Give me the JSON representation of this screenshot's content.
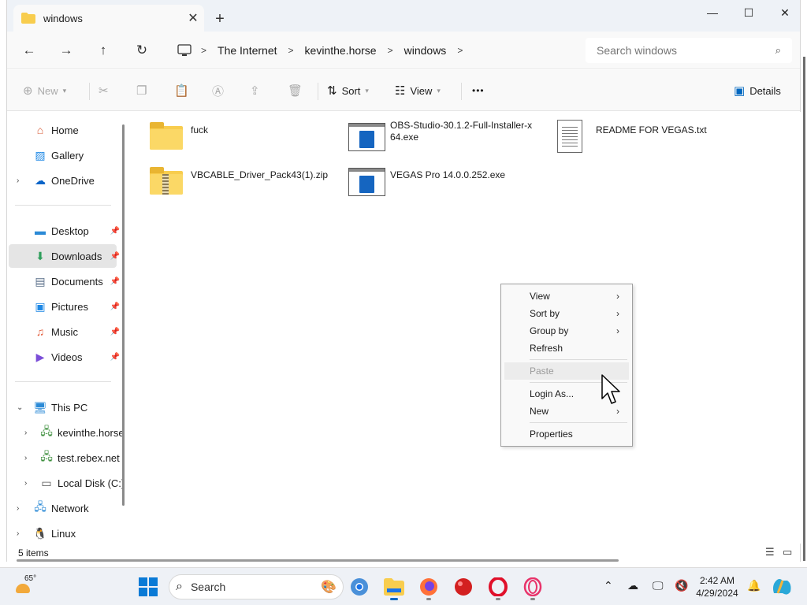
{
  "window": {
    "tab_title": "windows",
    "new_tab": "+",
    "controls": {
      "minimize": "—",
      "maximize": "☐",
      "close": "✕"
    }
  },
  "nav": {
    "back": "←",
    "forward": "→",
    "up": "↑",
    "refresh": "↻",
    "breadcrumbs": [
      "The Internet",
      "kevinthe.horse",
      "windows"
    ],
    "search_placeholder": "Search windows"
  },
  "toolbar": {
    "new_label": "New",
    "sort_label": "Sort",
    "view_label": "View",
    "more_label": "•••",
    "details_label": "Details"
  },
  "sidebar": {
    "items": [
      {
        "label": "Home",
        "icon": "home-icon"
      },
      {
        "label": "Gallery",
        "icon": "gallery-icon"
      },
      {
        "label": "OneDrive",
        "icon": "onedrive-icon"
      },
      {
        "label": "Desktop",
        "icon": "desktop-icon"
      },
      {
        "label": "Downloads",
        "icon": "downloads-icon"
      },
      {
        "label": "Documents",
        "icon": "documents-icon"
      },
      {
        "label": "Pictures",
        "icon": "pictures-icon"
      },
      {
        "label": "Music",
        "icon": "music-icon"
      },
      {
        "label": "Videos",
        "icon": "videos-icon"
      },
      {
        "label": "This PC",
        "icon": "this-pc-icon"
      },
      {
        "label": "kevinthe.horse",
        "icon": "network-drive-icon"
      },
      {
        "label": "test.rebex.net",
        "icon": "network-drive-icon"
      },
      {
        "label": "Local Disk (C:)",
        "icon": "disk-icon"
      },
      {
        "label": "Network",
        "icon": "network-icon"
      },
      {
        "label": "Linux",
        "icon": "linux-icon"
      }
    ]
  },
  "files": [
    {
      "name": "fuck",
      "type": "folder"
    },
    {
      "name": "OBS-Studio-30.1.2-Full-Installer-x64.exe",
      "type": "exe"
    },
    {
      "name": "README FOR VEGAS.txt",
      "type": "txt"
    },
    {
      "name": "VBCABLE_Driver_Pack43(1).zip",
      "type": "zip"
    },
    {
      "name": "VEGAS Pro 14.0.0.252.exe",
      "type": "exe"
    }
  ],
  "status": {
    "item_count": "5 items"
  },
  "context_menu": {
    "items": [
      {
        "label": "View"
      },
      {
        "label": "Sort by"
      },
      {
        "label": "Group by"
      },
      {
        "label": "Refresh"
      },
      {
        "label": "Paste"
      },
      {
        "label": "Login As..."
      },
      {
        "label": "New"
      },
      {
        "label": "Properties"
      }
    ],
    "submenu_arrow": "›"
  },
  "taskbar": {
    "weather_temp": "65°",
    "search_label": "Search",
    "time": "2:42 AM",
    "date": "4/29/2024"
  },
  "colors": {
    "accent": "#0067c0",
    "folder": "#f8cd4e",
    "selection": "#e5e5e5"
  }
}
